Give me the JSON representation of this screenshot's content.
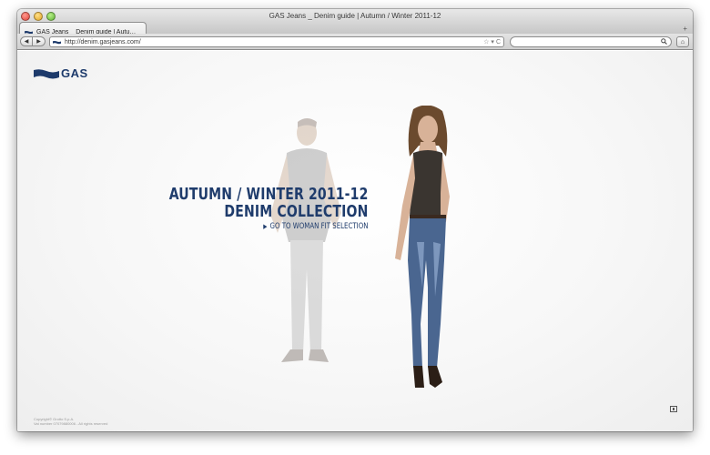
{
  "window": {
    "title": "GAS Jeans _ Denim guide | Autumn / Winter 2011-12"
  },
  "tab": {
    "label": "GAS Jeans _ Denim guide | Autu…",
    "new_tab": "+"
  },
  "toolbar": {
    "back_glyph": "◀",
    "forward_glyph": "▶",
    "url": "http://denim.gasjeans.com/",
    "bookmark_glyph": "☆",
    "dropdown_glyph": "▾",
    "reload_glyph": "C",
    "search_placeholder": "",
    "search_glyph": "🔍",
    "home_glyph": "⌂"
  },
  "page": {
    "logo_text": "GAS",
    "headline_line1": "AUTUMN / WINTER 2011-12",
    "headline_line2": "DENIM COLLECTION",
    "cta_arrow": "▶",
    "cta_text": "GO TO WOMAN FIT SELECTION",
    "copyright_line1": "Copyright© Grotto S.p.A.",
    "copyright_line2": "Vat number 07079880006 - All rights reserved"
  },
  "colors": {
    "brand": "#1d3a6b",
    "headline": "#1f3c6c"
  },
  "icons": {
    "logo": "gas-flag-icon",
    "fullscreen": "fullscreen-icon"
  }
}
